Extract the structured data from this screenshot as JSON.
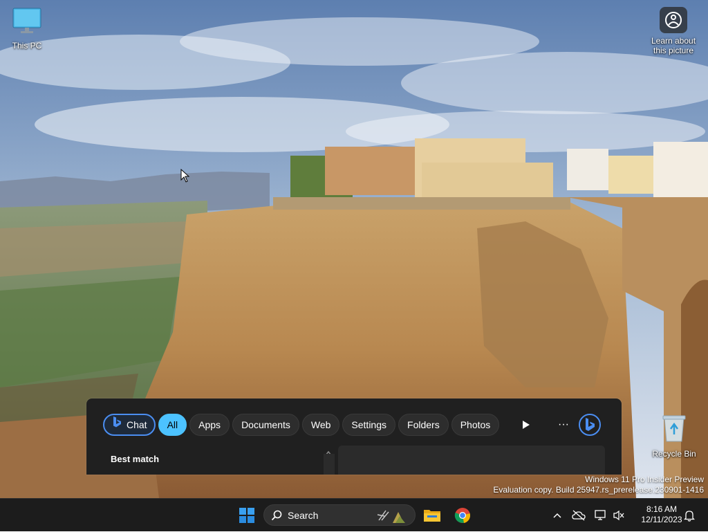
{
  "desktop": {
    "icons": [
      {
        "name": "this-pc",
        "label": "This PC"
      },
      {
        "name": "learn-about-picture",
        "label": "Learn about\nthis picture"
      },
      {
        "name": "recycle-bin",
        "label": "Recycle Bin"
      }
    ]
  },
  "watermark": {
    "line1": "Windows 11 Pro Insider Preview",
    "line2": "Evaluation copy. Build 25947.rs_prerelease.230901-1416"
  },
  "search_flyout": {
    "filters": [
      {
        "label": "Chat",
        "state": "chat"
      },
      {
        "label": "All",
        "state": "active"
      },
      {
        "label": "Apps"
      },
      {
        "label": "Documents"
      },
      {
        "label": "Web"
      },
      {
        "label": "Settings"
      },
      {
        "label": "Folders"
      },
      {
        "label": "Photos"
      }
    ],
    "more_label": "···",
    "best_match_heading": "Best match"
  },
  "taskbar": {
    "search_placeholder": "Search",
    "pinned": [
      "file-explorer",
      "google-chrome"
    ],
    "clock": {
      "time": "8:16 AM",
      "date": "12/11/2023"
    }
  },
  "colors": {
    "accent": "#4cc2ff",
    "chat_border": "#4b8ef2",
    "flyout_bg": "#202020",
    "taskbar_bg": "#1c1c1c"
  }
}
